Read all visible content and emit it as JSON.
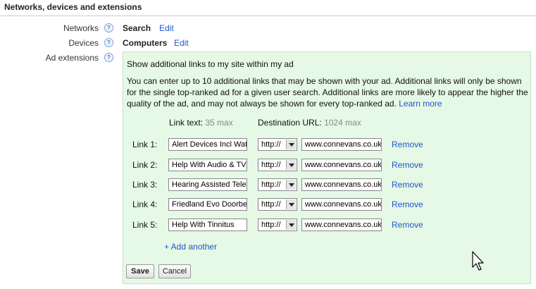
{
  "section": {
    "title": "Networks, devices and extensions"
  },
  "networks": {
    "label": "Networks",
    "value": "Search",
    "edit": "Edit"
  },
  "devices": {
    "label": "Devices",
    "value": "Computers",
    "edit": "Edit"
  },
  "ad_extensions": {
    "label": "Ad extensions",
    "checkbox_text": "Show additional links to my site within my ad",
    "description": "You can enter up to 10 additional links that may be shown with your ad. Additional links will only be shown for the single top-ranked ad for a given user search. Additional links are more likely to appear the higher the quality of the ad, and may not always be shown for every top-ranked ad.",
    "learn_more": "Learn more",
    "link_text_header": "Link text:",
    "link_text_max": "35 max",
    "dest_url_header": "Destination URL:",
    "dest_url_max": "1024 max",
    "links": [
      {
        "label": "Link 1:",
        "text": "Alert Devices Incl Wat",
        "protocol": "http://",
        "url": "www.connevans.co.uk/",
        "remove": "Remove"
      },
      {
        "label": "Link 2:",
        "text": "Help With Audio & TV",
        "protocol": "http://",
        "url": "www.connevans.co.uk/",
        "remove": "Remove"
      },
      {
        "label": "Link 3:",
        "text": "Hearing Assisted Tele",
        "protocol": "http://",
        "url": "www.connevans.co.uk/",
        "remove": "Remove"
      },
      {
        "label": "Link 4:",
        "text": "Friedland Evo Doorbe",
        "protocol": "http://",
        "url": "www.connevans.co.uk/",
        "remove": "Remove"
      },
      {
        "label": "Link 5:",
        "text": "Help With Tinnitus",
        "protocol": "http://",
        "url": "www.connevans.co.uk/",
        "remove": "Remove"
      }
    ],
    "add_another": "+ Add another",
    "save": "Save",
    "cancel": "Cancel"
  }
}
